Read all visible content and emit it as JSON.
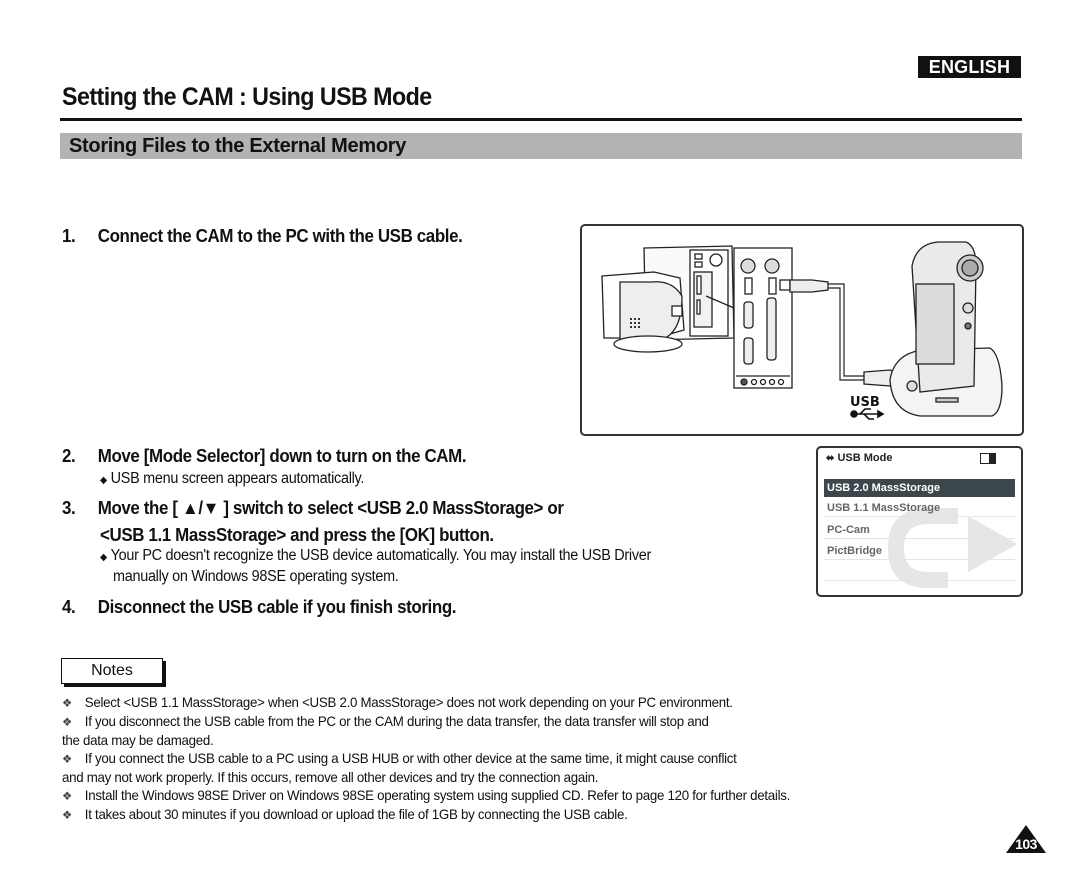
{
  "header": {
    "language_badge": "ENGLISH",
    "page_title": "Setting the CAM : Using USB Mode",
    "section_title": "Storing Files to the External Memory"
  },
  "steps": [
    {
      "number": "1.",
      "text": "Connect the CAM to the PC with the USB cable.",
      "notes": []
    },
    {
      "number": "2.",
      "text": "Move [Mode Selector] down to turn on the CAM.",
      "notes": [
        "USB menu screen appears automatically."
      ]
    },
    {
      "number": "3.",
      "text_line1": "Move the [ ▲/▼ ] switch to select <USB 2.0 MassStorage> or",
      "text_line2": "<USB 1.1 MassStorage> and press the [OK] button.",
      "notes_line1": "Your PC doesn't recognize the USB device automatically. You may install the USB Driver",
      "notes_line2": "manually on Windows 98SE operating system."
    },
    {
      "number": "4.",
      "text": "Disconnect the USB cable if you finish storing."
    }
  ],
  "illustration": {
    "usb_label": "USB",
    "icon": "usb-icon"
  },
  "lcd_screen": {
    "title": "USB Mode",
    "items": [
      "USB 2.0 MassStorage",
      "USB 1.1 MassStorage",
      "PC-Cam",
      "PictBridge"
    ],
    "selected_index": 0
  },
  "notes": {
    "label": "Notes",
    "items": [
      {
        "lines": [
          "Select <USB 1.1 MassStorage> when <USB 2.0 MassStorage> does not work depending on your PC environment."
        ]
      },
      {
        "lines": [
          "If you disconnect the USB cable from the PC or the CAM during the data transfer, the data transfer will stop and",
          "the data may be damaged."
        ]
      },
      {
        "lines": [
          "If you connect the USB cable to a PC using a USB HUB or with other device at the same time, it might cause conflict",
          "and may not work properly. If this occurs, remove all other devices and try the connection again."
        ]
      },
      {
        "lines": [
          "Install the Windows 98SE Driver on Windows 98SE operating system using supplied CD. Refer to page 120 for further details."
        ]
      },
      {
        "lines": [
          "It takes about 30 minutes if you download or upload the file of 1GB by connecting the USB cable."
        ]
      }
    ]
  },
  "footer": {
    "page_number": "103"
  },
  "bullets": {
    "diamond": "◆",
    "note": "❖"
  }
}
